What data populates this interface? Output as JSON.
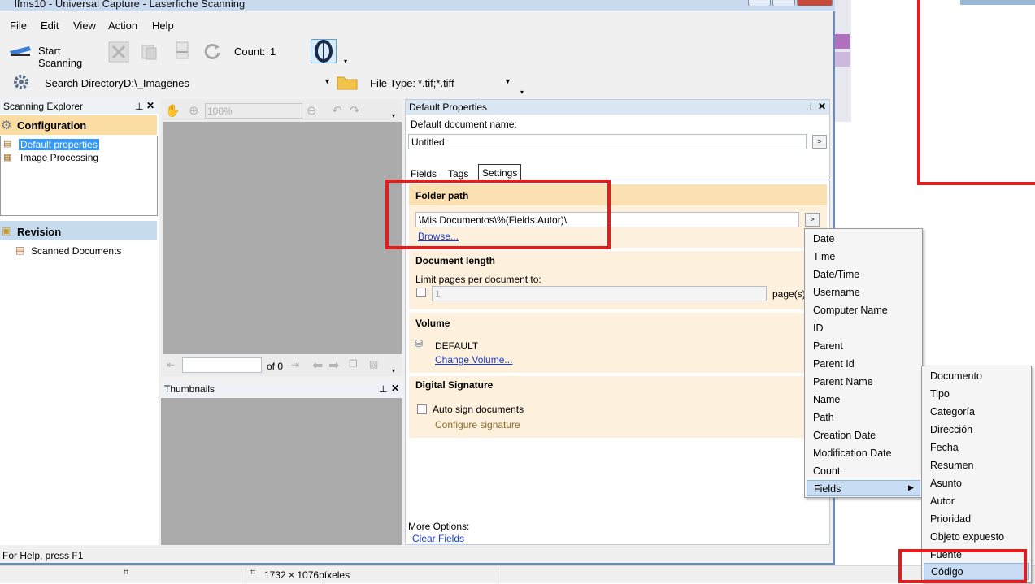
{
  "window": {
    "title": "lfms10 - Universal Capture - Laserfiche Scanning"
  },
  "menu": [
    "File",
    "Edit",
    "View",
    "Action",
    "Help"
  ],
  "toolbar": {
    "start_scanning": "Start Scanning",
    "count_label": "Count:",
    "count_value": "1",
    "search_dir_label": "Search Directory:",
    "search_dir_value": "D:\\_Imagenes",
    "file_type_label": "File Type:",
    "file_type_value": "*.tif;*.tiff"
  },
  "explorer": {
    "title": "Scanning Explorer",
    "config_title": "Configuration",
    "items": [
      "Default properties",
      "Image Processing"
    ],
    "revision_title": "Revision",
    "revision_items": [
      "Scanned Documents"
    ]
  },
  "viewer": {
    "zoom": "100%",
    "page_of": "of 0"
  },
  "thumbnails": {
    "title": "Thumbnails"
  },
  "props": {
    "title": "Default Properties",
    "doc_name_label": "Default document name:",
    "doc_name_value": "Untitled",
    "tabs": [
      "Fields",
      "Tags",
      "Settings"
    ],
    "folder_title": "Folder path",
    "folder_value": "\\Mis Documentos\\%(Fields.Autor)\\",
    "browse": "Browse...",
    "doclen_title": "Document length",
    "limit_label": "Limit pages per document to:",
    "limit_value": "1",
    "pages_suffix": "page(s)",
    "volume_title": "Volume",
    "volume_value": "DEFAULT",
    "change_volume": "Change Volume...",
    "sig_title": "Digital Signature",
    "auto_sign": "Auto sign documents",
    "configure_sig": "Configure signature",
    "more_options": "More Options:",
    "clear_fields": "Clear Fields"
  },
  "context_menu": [
    "Date",
    "Time",
    "Date/Time",
    "Username",
    "Computer Name",
    "ID",
    "Parent",
    "Parent Id",
    "Parent Name",
    "Name",
    "Path",
    "Creation Date",
    "Modification Date",
    "Count",
    "Fields"
  ],
  "submenu": [
    "Documento",
    "Tipo",
    "Categoría",
    "Dirección",
    "Fecha",
    "Resumen",
    "Asunto",
    "Autor",
    "Prioridad",
    "Objeto expuesto",
    "Fuente",
    "Código"
  ],
  "status": {
    "help": "For Help, press F1",
    "dimensions": "1732 × 1076píxeles"
  },
  "colors": {
    "accent_highlight": "#c8ddf4",
    "section_bg": "#fdf0dc",
    "section_head": "#fbe0b2",
    "red_annotation": "#e11d1d"
  }
}
